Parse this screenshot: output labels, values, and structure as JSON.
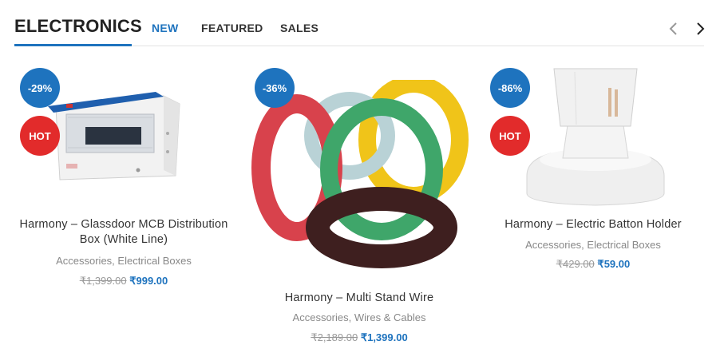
{
  "section": {
    "title": "ELECTRONICS",
    "tabs": [
      {
        "label": "NEW",
        "active": true
      },
      {
        "label": "FEATURED",
        "active": false
      },
      {
        "label": "SALES",
        "active": false
      }
    ],
    "nav_prev_icon": "chevron-left-icon",
    "nav_next_icon": "chevron-right-icon"
  },
  "products": [
    {
      "name": "Harmony – Glassdoor MCB Distribution Box (White Line)",
      "discount": "-29%",
      "hot": "HOT",
      "categories": [
        "Accessories",
        "Electrical Boxes"
      ],
      "old_price": "₹1,399.00",
      "price": "₹999.00"
    },
    {
      "name": "Harmony – Multi Stand Wire",
      "discount": "-36%",
      "categories": [
        "Accessories",
        "Wires & Cables"
      ],
      "old_price": "₹2,189.00",
      "price": "₹1,399.00"
    },
    {
      "name": "Harmony – Electric Batton Holder",
      "discount": "-86%",
      "hot": "HOT",
      "categories": [
        "Accessories",
        "Electrical Boxes"
      ],
      "old_price": "₹429.00",
      "price": "₹59.00"
    }
  ],
  "colors": {
    "accent": "#1e73be",
    "hot": "#e22b2b"
  }
}
